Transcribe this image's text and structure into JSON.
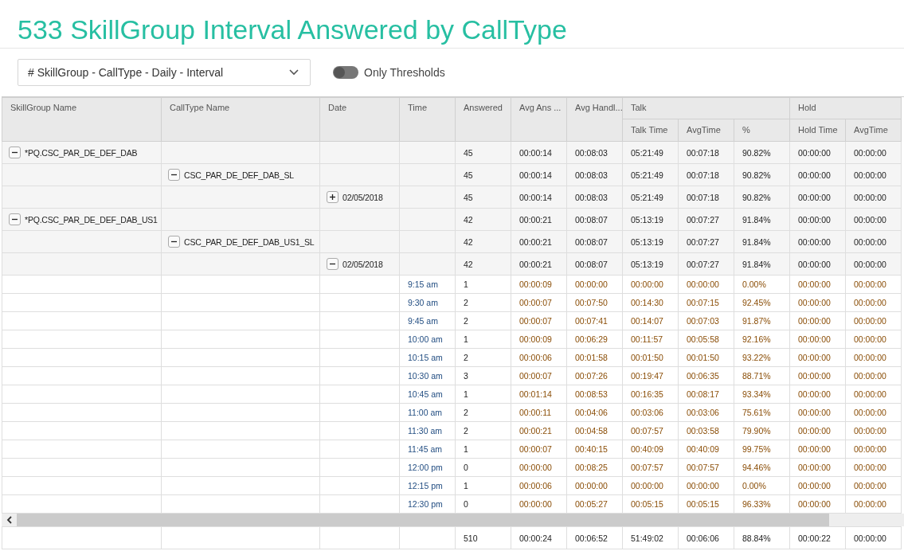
{
  "title": "533 SkillGroup Interval Answered by CallType",
  "view_select": {
    "value": "# SkillGroup - CallType - Daily - Interval"
  },
  "toggle": {
    "label": "Only Thresholds",
    "on": false
  },
  "table": {
    "columns": [
      "SkillGroup Name",
      "CallType Name",
      "Date",
      "Time",
      "Answered",
      "Avg Ans ...",
      "Avg Handl..."
    ],
    "groups": [
      {
        "label": "Talk",
        "columns": [
          "Talk Time",
          "AvgTime",
          "%"
        ]
      },
      {
        "label": "Hold",
        "columns": [
          "Hold Time",
          "AvgTime"
        ]
      }
    ],
    "skill_groups": [
      {
        "name": "*PQ.CSC_PAR_DE_DEF_DAB",
        "expanded": true,
        "values": [
          "45",
          "00:00:14",
          "00:08:03",
          "05:21:49",
          "00:07:18",
          "90.82%",
          "00:00:00",
          "00:00:00"
        ],
        "children": [
          {
            "name": "CSC_PAR_DE_DEF_DAB_SL",
            "expanded": true,
            "values": [
              "45",
              "00:00:14",
              "00:08:03",
              "05:21:49",
              "00:07:18",
              "90.82%",
              "00:00:00",
              "00:00:00"
            ],
            "children": [
              {
                "date": "02/05/2018",
                "expanded": false,
                "values": [
                  "45",
                  "00:00:14",
                  "00:08:03",
                  "05:21:49",
                  "00:07:18",
                  "90.82%",
                  "00:00:00",
                  "00:00:00"
                ]
              }
            ]
          }
        ]
      },
      {
        "name": "*PQ.CSC_PAR_DE_DEF_DAB_US1",
        "expanded": true,
        "values": [
          "42",
          "00:00:21",
          "00:08:07",
          "05:13:19",
          "00:07:27",
          "91.84%",
          "00:00:00",
          "00:00:00"
        ],
        "children": [
          {
            "name": "CSC_PAR_DE_DEF_DAB_US1_SL",
            "expanded": true,
            "values": [
              "42",
              "00:00:21",
              "00:08:07",
              "05:13:19",
              "00:07:27",
              "91.84%",
              "00:00:00",
              "00:00:00"
            ],
            "children": [
              {
                "date": "02/05/2018",
                "expanded": true,
                "values": [
                  "42",
                  "00:00:21",
                  "00:08:07",
                  "05:13:19",
                  "00:07:27",
                  "91.84%",
                  "00:00:00",
                  "00:00:00"
                ],
                "children": [
                  {
                    "time": "9:15 am",
                    "values": [
                      "1",
                      "00:00:09",
                      "00:00:00",
                      "00:00:00",
                      "00:00:00",
                      "0.00%",
                      "00:00:00",
                      "00:00:00"
                    ]
                  },
                  {
                    "time": "9:30 am",
                    "values": [
                      "2",
                      "00:00:07",
                      "00:07:50",
                      "00:14:30",
                      "00:07:15",
                      "92.45%",
                      "00:00:00",
                      "00:00:00"
                    ]
                  },
                  {
                    "time": "9:45 am",
                    "values": [
                      "2",
                      "00:00:07",
                      "00:07:41",
                      "00:14:07",
                      "00:07:03",
                      "91.87%",
                      "00:00:00",
                      "00:00:00"
                    ]
                  },
                  {
                    "time": "10:00 am",
                    "values": [
                      "1",
                      "00:00:09",
                      "00:06:29",
                      "00:11:57",
                      "00:05:58",
                      "92.16%",
                      "00:00:00",
                      "00:00:00"
                    ]
                  },
                  {
                    "time": "10:15 am",
                    "values": [
                      "2",
                      "00:00:06",
                      "00:01:58",
                      "00:01:50",
                      "00:01:50",
                      "93.22%",
                      "00:00:00",
                      "00:00:00"
                    ]
                  },
                  {
                    "time": "10:30 am",
                    "values": [
                      "3",
                      "00:00:07",
                      "00:07:26",
                      "00:19:47",
                      "00:06:35",
                      "88.71%",
                      "00:00:00",
                      "00:00:00"
                    ]
                  },
                  {
                    "time": "10:45 am",
                    "values": [
                      "1",
                      "00:01:14",
                      "00:08:53",
                      "00:16:35",
                      "00:08:17",
                      "93.34%",
                      "00:00:00",
                      "00:00:00"
                    ]
                  },
                  {
                    "time": "11:00 am",
                    "values": [
                      "2",
                      "00:00:11",
                      "00:04:06",
                      "00:03:06",
                      "00:03:06",
                      "75.61%",
                      "00:00:00",
                      "00:00:00"
                    ]
                  },
                  {
                    "time": "11:30 am",
                    "values": [
                      "2",
                      "00:00:21",
                      "00:04:58",
                      "00:07:57",
                      "00:03:58",
                      "79.90%",
                      "00:00:00",
                      "00:00:00"
                    ]
                  },
                  {
                    "time": "11:45 am",
                    "values": [
                      "1",
                      "00:00:07",
                      "00:40:15",
                      "00:40:09",
                      "00:40:09",
                      "99.75%",
                      "00:00:00",
                      "00:00:00"
                    ]
                  },
                  {
                    "time": "12:00 pm",
                    "values": [
                      "0",
                      "00:00:00",
                      "00:08:25",
                      "00:07:57",
                      "00:07:57",
                      "94.46%",
                      "00:00:00",
                      "00:00:00"
                    ]
                  },
                  {
                    "time": "12:15 pm",
                    "values": [
                      "1",
                      "00:00:06",
                      "00:00:00",
                      "00:00:00",
                      "00:00:00",
                      "0.00%",
                      "00:00:00",
                      "00:00:00"
                    ]
                  },
                  {
                    "time": "12:30 pm",
                    "values": [
                      "0",
                      "00:00:00",
                      "00:05:27",
                      "00:05:15",
                      "00:05:15",
                      "96.33%",
                      "00:00:00",
                      "00:00:00"
                    ]
                  }
                ]
              }
            ]
          }
        ]
      }
    ],
    "totals": [
      "510",
      "00:00:24",
      "00:06:52",
      "51:49:02",
      "00:06:06",
      "88.84%",
      "00:00:22",
      "00:00:00"
    ]
  }
}
